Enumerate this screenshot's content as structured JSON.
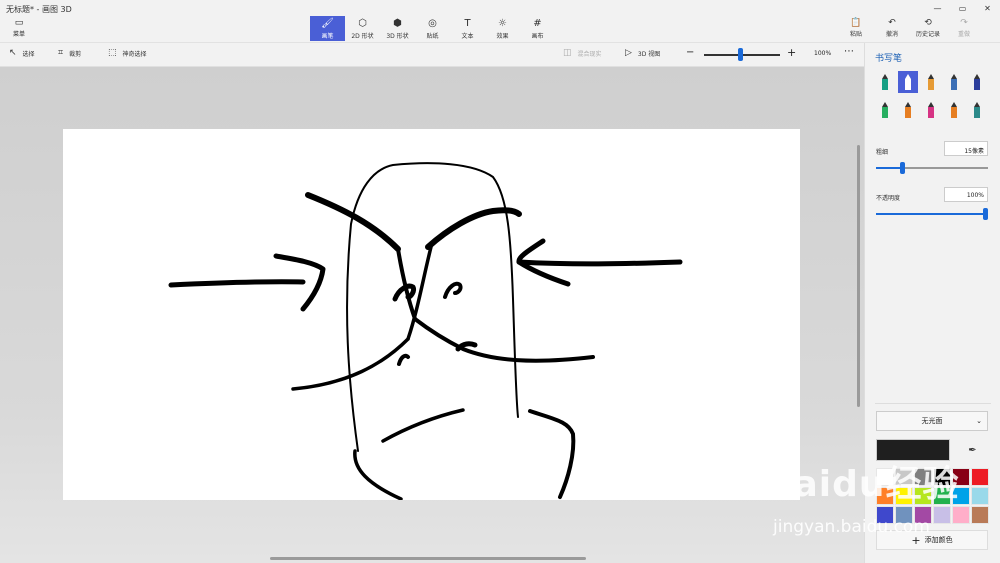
{
  "window": {
    "title": "无标题* - 画图 3D",
    "controls": [
      "—",
      "▭",
      "✕"
    ]
  },
  "menu": {
    "label": "菜单"
  },
  "tools": [
    {
      "label": "画笔",
      "icon": "brush-icon",
      "glyph": "🖌",
      "active": true
    },
    {
      "label": "2D 形状",
      "icon": "2d-shapes-icon",
      "glyph": "⬡",
      "active": false
    },
    {
      "label": "3D 形状",
      "icon": "3d-shapes-icon",
      "glyph": "⬢",
      "active": false
    },
    {
      "label": "贴纸",
      "icon": "sticker-icon",
      "glyph": "◎",
      "active": false
    },
    {
      "label": "文本",
      "icon": "text-icon",
      "glyph": "T",
      "active": false
    },
    {
      "label": "效果",
      "icon": "effects-icon",
      "glyph": "☼",
      "active": false
    },
    {
      "label": "画布",
      "icon": "canvas-icon",
      "glyph": "#",
      "active": false
    }
  ],
  "right_tools": [
    {
      "label": "粘贴",
      "icon": "paste-icon",
      "glyph": "📋",
      "dim": false
    },
    {
      "label": "撤消",
      "icon": "undo-icon",
      "glyph": "↶",
      "dim": false
    },
    {
      "label": "历史记录",
      "icon": "history-icon",
      "glyph": "⟲",
      "dim": false
    },
    {
      "label": "重做",
      "icon": "redo-icon",
      "glyph": "↷",
      "dim": true
    }
  ],
  "toolbar2": {
    "select": "选择",
    "crop": "裁剪",
    "magic_select": "神奇选择",
    "mixed_reality": "混合现实",
    "view_3d": "3D 视图",
    "zoom_value": "100%",
    "zoom_level": 0.45
  },
  "panel": {
    "title": "书写笔",
    "thickness_label": "粗细",
    "thickness_value": "15像素",
    "thickness_level": 0.23,
    "opacity_label": "不透明度",
    "opacity_value": "100%",
    "opacity_level": 1.0,
    "finish": "无光面",
    "add_color": "添加颜色",
    "current_color": "#1f1f1f",
    "brushes": [
      {
        "name": "marker-icon",
        "color": "#16a085"
      },
      {
        "name": "calligraphy-pen-icon",
        "color": "#4a5fd6"
      },
      {
        "name": "oil-brush-icon",
        "color": "#e69b35"
      },
      {
        "name": "watercolor-icon",
        "color": "#3b6fb6"
      },
      {
        "name": "pixel-pen-icon",
        "color": "#2c3e9c"
      },
      {
        "name": "pencil-icon",
        "color": "#27ae60"
      },
      {
        "name": "eraser-icon",
        "color": "#e67e22"
      },
      {
        "name": "crayon-icon",
        "color": "#d63384"
      },
      {
        "name": "spray-can-icon",
        "color": "#e67e22"
      },
      {
        "name": "fill-icon",
        "color": "#2c8a8a"
      }
    ],
    "swatches": [
      "#ffffff",
      "#c8c8c8",
      "#808080",
      "#000000",
      "#880015",
      "#ed1c24",
      "#ff7f27",
      "#fff200",
      "#b5e61d",
      "#22b14c",
      "#00a2e8",
      "#99d9ea",
      "#3f48cc",
      "#7092be",
      "#a349a4",
      "#c8bfe7",
      "#ffaec9",
      "#b97a57"
    ]
  },
  "watermark": {
    "logo": "Baidu经验",
    "url": "jingyan.baidu.com"
  }
}
